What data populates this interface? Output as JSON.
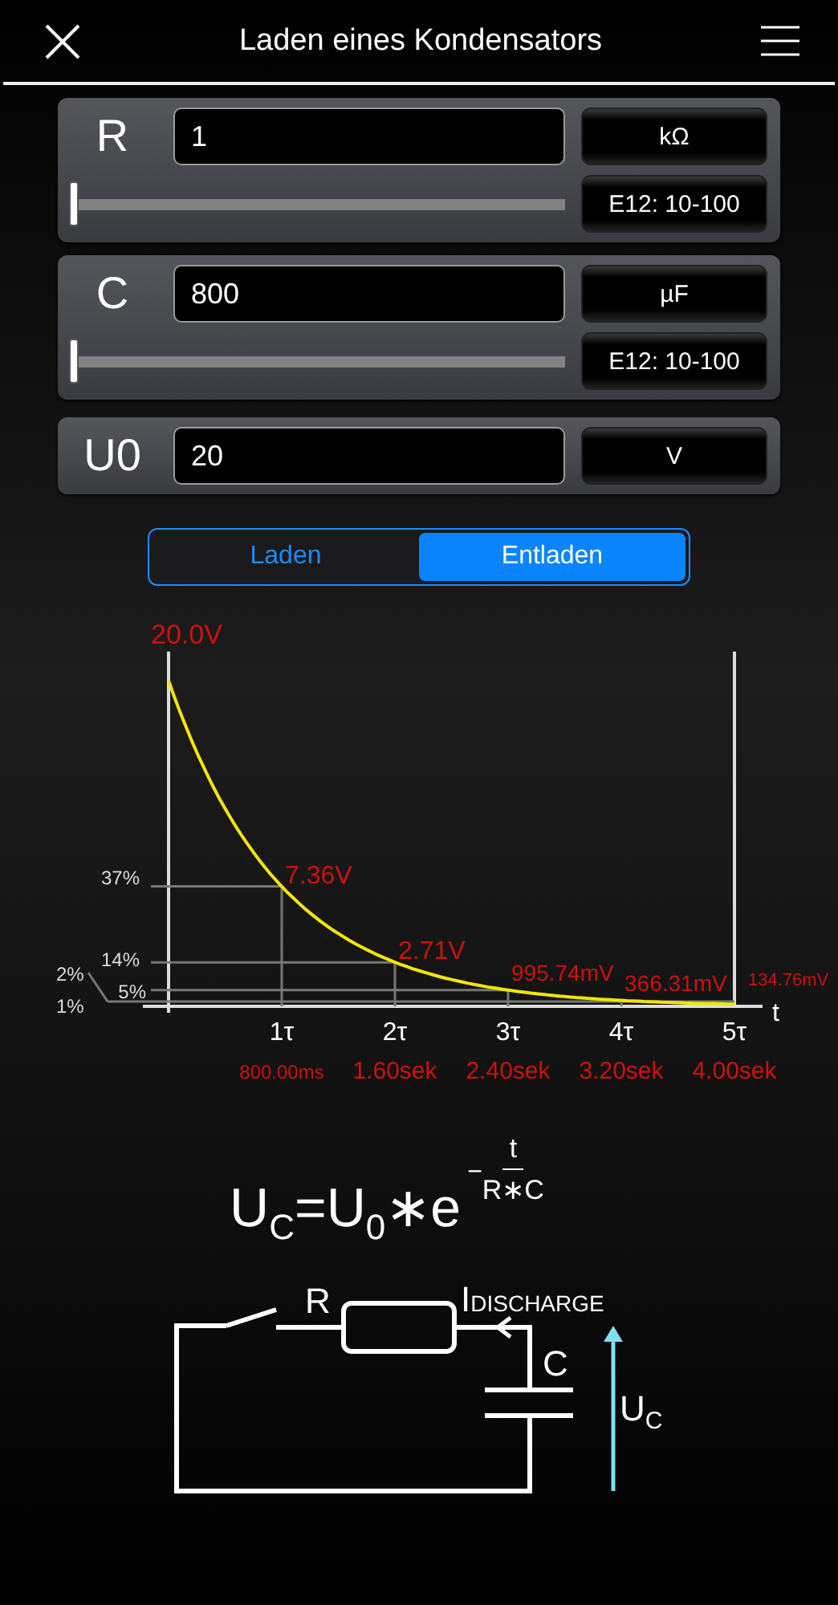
{
  "header": {
    "title": "Laden eines Kondensators"
  },
  "parameters": [
    {
      "kind": "slider",
      "symbol": "R",
      "value": "1",
      "unit": "kΩ",
      "series": "E12: 10-100",
      "level": 0
    },
    {
      "kind": "slider",
      "symbol": "C",
      "value": "800",
      "unit": "µF",
      "series": "E12: 10-100",
      "level": 0
    },
    {
      "kind": "plain",
      "symbol": "U0",
      "value": "20",
      "unit": "V"
    }
  ],
  "mode_switch": [
    {
      "label": "Laden",
      "selected": false
    },
    {
      "label": "Entladen",
      "selected": true
    }
  ],
  "graph": {
    "max_label": "20.0V",
    "axis_label": "t",
    "percent_labels": [
      "37%",
      "14%",
      "5%",
      "2%",
      "1%"
    ],
    "tau_labels": [
      "1τ",
      "2τ",
      "3τ",
      "4τ",
      "5τ"
    ],
    "time_labels": [
      "800.00ms",
      "1.60sek",
      "2.40sek",
      "3.20sek",
      "4.00sek"
    ],
    "value_labels": [
      "7.36V",
      "2.71V",
      "995.74mV",
      "366.31mV",
      "134.76mV"
    ]
  },
  "formula": {
    "lhs": "U$_{C}$=U$_{0}$∗e",
    "sign": "−",
    "numerator": "t",
    "denominator": "R∗C"
  },
  "circuit": {
    "resistor": "R",
    "current": {
      "text": "I",
      "sub": "DISCHARGE"
    },
    "capacitor": "C",
    "voltage": {
      "text": "U",
      "sub": "C"
    }
  }
}
